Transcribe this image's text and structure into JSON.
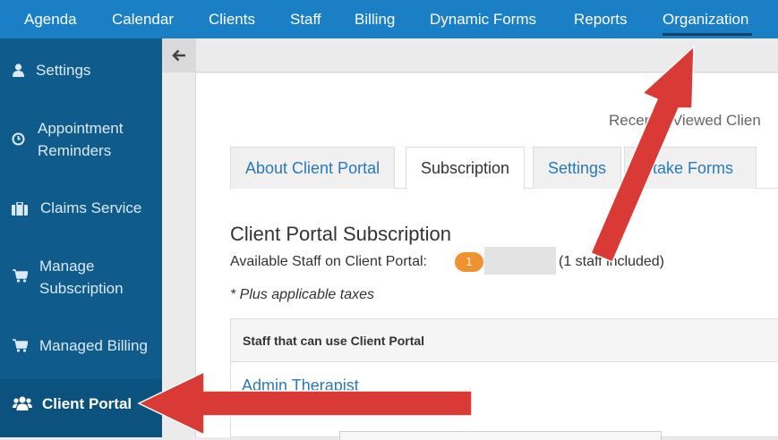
{
  "topnav": {
    "items": [
      {
        "label": "Agenda"
      },
      {
        "label": "Calendar"
      },
      {
        "label": "Clients"
      },
      {
        "label": "Staff"
      },
      {
        "label": "Billing"
      },
      {
        "label": "Dynamic Forms"
      },
      {
        "label": "Reports"
      },
      {
        "label": "Organization",
        "active": true
      }
    ]
  },
  "sidebar": {
    "items": [
      {
        "label": "Settings",
        "icon": "user-icon"
      },
      {
        "label_1": "Appointment",
        "label_2": "Reminders",
        "icon": "clock-icon"
      },
      {
        "label": "Claims Service",
        "icon": "briefcase-icon"
      },
      {
        "label_1": "Manage",
        "label_2": "Subscription",
        "icon": "cart-icon"
      },
      {
        "label": "Managed Billing",
        "icon": "cart-icon"
      },
      {
        "label": "Client Portal",
        "icon": "users-icon",
        "active": true
      }
    ]
  },
  "header": {
    "recently_viewed": "Recently Viewed Clien"
  },
  "tabs": [
    {
      "label": "About Client Portal"
    },
    {
      "label": "Subscription",
      "active": true
    },
    {
      "label": "Settings"
    },
    {
      "label": "Intake Forms"
    }
  ],
  "subscription": {
    "title": "Client Portal Subscription",
    "available_label": "Available Staff on Client Portal:",
    "available_count": "1",
    "included_text": "(1 staff included)",
    "taxes_note": "* Plus applicable taxes"
  },
  "staff_table": {
    "header": "Staff that can use Client Portal",
    "rows": [
      {
        "name": "Admin Therapist"
      }
    ]
  },
  "colors": {
    "topnav": "#1a7fc4",
    "sidebar": "#0f5c8c",
    "link": "#2a7ab8",
    "badge": "#f0922f",
    "arrow": "#d93a36"
  }
}
